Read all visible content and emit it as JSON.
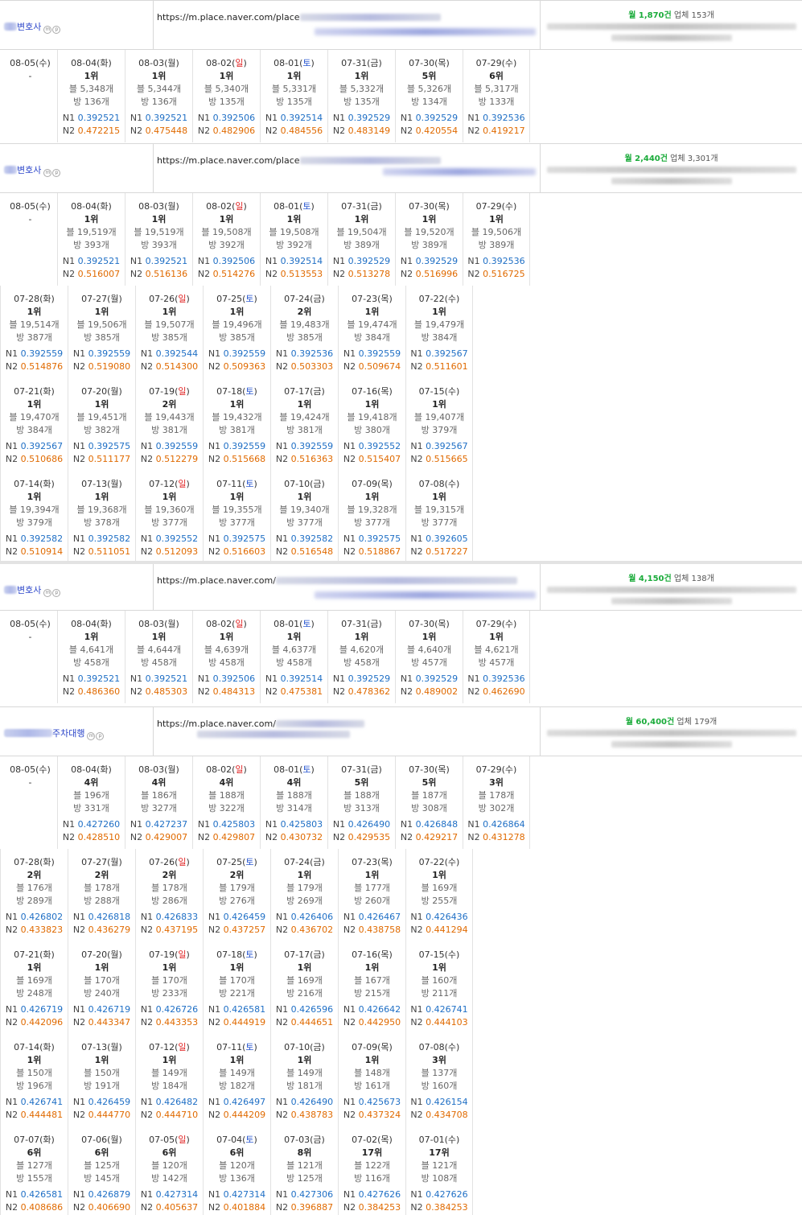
{
  "blocks": [
    {
      "name": "변호사",
      "name_blur": "short",
      "url": "https://m.place.naver.com/place",
      "monthly": "월 1,870건",
      "total": "업체 153개",
      "today": {
        "date": "08-05(수)",
        "rank": "-"
      },
      "rows": [
        [
          {
            "d": "08-04",
            "w": "화",
            "t": "",
            "r": "1위",
            "b": "블 5,348개",
            "v": "방 136개",
            "n1": "0.392521",
            "n2": "0.472215"
          },
          {
            "d": "08-03",
            "w": "월",
            "t": "",
            "r": "1위",
            "b": "블 5,344개",
            "v": "방 136개",
            "n1": "0.392521",
            "n2": "0.475448"
          },
          {
            "d": "08-02",
            "w": "일",
            "t": "sun",
            "r": "1위",
            "b": "블 5,340개",
            "v": "방 135개",
            "n1": "0.392506",
            "n2": "0.482906"
          },
          {
            "d": "08-01",
            "w": "토",
            "t": "sat",
            "r": "1위",
            "b": "블 5,331개",
            "v": "방 135개",
            "n1": "0.392514",
            "n2": "0.484556"
          },
          {
            "d": "07-31",
            "w": "금",
            "t": "",
            "r": "1위",
            "b": "블 5,332개",
            "v": "방 135개",
            "n1": "0.392529",
            "n2": "0.483149"
          },
          {
            "d": "07-30",
            "w": "목",
            "t": "",
            "r": "5위",
            "b": "블 5,326개",
            "v": "방 134개",
            "n1": "0.392529",
            "n2": "0.420554"
          },
          {
            "d": "07-29",
            "w": "수",
            "t": "",
            "r": "6위",
            "b": "블 5,317개",
            "v": "방 133개",
            "n1": "0.392536",
            "n2": "0.419217"
          }
        ]
      ]
    },
    {
      "name": "변호사",
      "name_blur": "short",
      "url": "https://m.place.naver.com/place",
      "monthly": "월 2,440건",
      "total": "업체 3,301개",
      "today": {
        "date": "08-05(수)",
        "rank": "-"
      },
      "rows": [
        [
          {
            "d": "08-04",
            "w": "화",
            "t": "",
            "r": "1위",
            "b": "블 19,519개",
            "v": "방 393개",
            "n1": "0.392521",
            "n2": "0.516007"
          },
          {
            "d": "08-03",
            "w": "월",
            "t": "",
            "r": "1위",
            "b": "블 19,519개",
            "v": "방 393개",
            "n1": "0.392521",
            "n2": "0.516136"
          },
          {
            "d": "08-02",
            "w": "일",
            "t": "sun",
            "r": "1위",
            "b": "블 19,508개",
            "v": "방 392개",
            "n1": "0.392506",
            "n2": "0.514276"
          },
          {
            "d": "08-01",
            "w": "토",
            "t": "sat",
            "r": "1위",
            "b": "블 19,508개",
            "v": "방 392개",
            "n1": "0.392514",
            "n2": "0.513553"
          },
          {
            "d": "07-31",
            "w": "금",
            "t": "",
            "r": "1위",
            "b": "블 19,504개",
            "v": "방 389개",
            "n1": "0.392529",
            "n2": "0.513278"
          },
          {
            "d": "07-30",
            "w": "목",
            "t": "",
            "r": "1위",
            "b": "블 19,520개",
            "v": "방 389개",
            "n1": "0.392529",
            "n2": "0.516996"
          },
          {
            "d": "07-29",
            "w": "수",
            "t": "",
            "r": "1위",
            "b": "블 19,506개",
            "v": "방 389개",
            "n1": "0.392536",
            "n2": "0.516725"
          }
        ],
        [
          {
            "d": "07-28",
            "w": "화",
            "t": "",
            "r": "1위",
            "b": "블 19,514개",
            "v": "방 387개",
            "n1": "0.392559",
            "n2": "0.514876"
          },
          {
            "d": "07-27",
            "w": "월",
            "t": "",
            "r": "1위",
            "b": "블 19,506개",
            "v": "방 385개",
            "n1": "0.392559",
            "n2": "0.519080"
          },
          {
            "d": "07-26",
            "w": "일",
            "t": "sun",
            "r": "1위",
            "b": "블 19,507개",
            "v": "방 385개",
            "n1": "0.392544",
            "n2": "0.514300"
          },
          {
            "d": "07-25",
            "w": "토",
            "t": "sat",
            "r": "1위",
            "b": "블 19,496개",
            "v": "방 385개",
            "n1": "0.392559",
            "n2": "0.509363"
          },
          {
            "d": "07-24",
            "w": "금",
            "t": "",
            "r": "2위",
            "b": "블 19,483개",
            "v": "방 385개",
            "n1": "0.392536",
            "n2": "0.503303"
          },
          {
            "d": "07-23",
            "w": "목",
            "t": "",
            "r": "1위",
            "b": "블 19,474개",
            "v": "방 384개",
            "n1": "0.392559",
            "n2": "0.509674"
          },
          {
            "d": "07-22",
            "w": "수",
            "t": "",
            "r": "1위",
            "b": "블 19,479개",
            "v": "방 384개",
            "n1": "0.392567",
            "n2": "0.511601"
          }
        ],
        [
          {
            "d": "07-21",
            "w": "화",
            "t": "",
            "r": "1위",
            "b": "블 19,470개",
            "v": "방 384개",
            "n1": "0.392567",
            "n2": "0.510686"
          },
          {
            "d": "07-20",
            "w": "월",
            "t": "",
            "r": "1위",
            "b": "블 19,451개",
            "v": "방 382개",
            "n1": "0.392575",
            "n2": "0.511177"
          },
          {
            "d": "07-19",
            "w": "일",
            "t": "sun",
            "r": "2위",
            "b": "블 19,443개",
            "v": "방 381개",
            "n1": "0.392559",
            "n2": "0.512279"
          },
          {
            "d": "07-18",
            "w": "토",
            "t": "sat",
            "r": "1위",
            "b": "블 19,432개",
            "v": "방 381개",
            "n1": "0.392559",
            "n2": "0.515668"
          },
          {
            "d": "07-17",
            "w": "금",
            "t": "",
            "r": "1위",
            "b": "블 19,424개",
            "v": "방 381개",
            "n1": "0.392559",
            "n2": "0.516363"
          },
          {
            "d": "07-16",
            "w": "목",
            "t": "",
            "r": "1위",
            "b": "블 19,418개",
            "v": "방 380개",
            "n1": "0.392552",
            "n2": "0.515407"
          },
          {
            "d": "07-15",
            "w": "수",
            "t": "",
            "r": "1위",
            "b": "블 19,407개",
            "v": "방 379개",
            "n1": "0.392567",
            "n2": "0.515665"
          }
        ],
        [
          {
            "d": "07-14",
            "w": "화",
            "t": "",
            "r": "1위",
            "b": "블 19,394개",
            "v": "방 379개",
            "n1": "0.392582",
            "n2": "0.510914"
          },
          {
            "d": "07-13",
            "w": "월",
            "t": "",
            "r": "1위",
            "b": "블 19,368개",
            "v": "방 378개",
            "n1": "0.392582",
            "n2": "0.511051"
          },
          {
            "d": "07-12",
            "w": "일",
            "t": "sun",
            "r": "1위",
            "b": "블 19,360개",
            "v": "방 377개",
            "n1": "0.392552",
            "n2": "0.512093"
          },
          {
            "d": "07-11",
            "w": "토",
            "t": "sat",
            "r": "1위",
            "b": "블 19,355개",
            "v": "방 377개",
            "n1": "0.392575",
            "n2": "0.516603"
          },
          {
            "d": "07-10",
            "w": "금",
            "t": "",
            "r": "1위",
            "b": "블 19,340개",
            "v": "방 377개",
            "n1": "0.392582",
            "n2": "0.516548"
          },
          {
            "d": "07-09",
            "w": "목",
            "t": "",
            "r": "1위",
            "b": "블 19,328개",
            "v": "방 377개",
            "n1": "0.392575",
            "n2": "0.518867"
          },
          {
            "d": "07-08",
            "w": "수",
            "t": "",
            "r": "1위",
            "b": "블 19,315개",
            "v": "방 377개",
            "n1": "0.392605",
            "n2": "0.517227"
          }
        ]
      ]
    },
    {
      "name": "변호사",
      "name_blur": "short",
      "url": "https://m.place.naver.com/",
      "monthly": "월 4,150건",
      "total": "업체 138개",
      "today": {
        "date": "08-05(수)",
        "rank": "-"
      },
      "rows": [
        [
          {
            "d": "08-04",
            "w": "화",
            "t": "",
            "r": "1위",
            "b": "블 4,641개",
            "v": "방 458개",
            "n1": "0.392521",
            "n2": "0.486360"
          },
          {
            "d": "08-03",
            "w": "월",
            "t": "",
            "r": "1위",
            "b": "블 4,644개",
            "v": "방 458개",
            "n1": "0.392521",
            "n2": "0.485303"
          },
          {
            "d": "08-02",
            "w": "일",
            "t": "sun",
            "r": "1위",
            "b": "블 4,639개",
            "v": "방 458개",
            "n1": "0.392506",
            "n2": "0.484313"
          },
          {
            "d": "08-01",
            "w": "토",
            "t": "sat",
            "r": "1위",
            "b": "블 4,637개",
            "v": "방 458개",
            "n1": "0.392514",
            "n2": "0.475381"
          },
          {
            "d": "07-31",
            "w": "금",
            "t": "",
            "r": "1위",
            "b": "블 4,620개",
            "v": "방 458개",
            "n1": "0.392529",
            "n2": "0.478362"
          },
          {
            "d": "07-30",
            "w": "목",
            "t": "",
            "r": "1위",
            "b": "블 4,640개",
            "v": "방 457개",
            "n1": "0.392529",
            "n2": "0.489002"
          },
          {
            "d": "07-29",
            "w": "수",
            "t": "",
            "r": "1위",
            "b": "블 4,621개",
            "v": "방 457개",
            "n1": "0.392536",
            "n2": "0.462690"
          }
        ]
      ]
    },
    {
      "name": "주차대행",
      "name_blur": "long",
      "url": "https://m.place.naver.com/",
      "monthly": "월 60,400건",
      "total": "업체 179개",
      "today": {
        "date": "08-05(수)",
        "rank": "-"
      },
      "rows": [
        [
          {
            "d": "08-04",
            "w": "화",
            "t": "",
            "r": "4위",
            "b": "블 196개",
            "v": "방 331개",
            "n1": "0.427260",
            "n2": "0.428510"
          },
          {
            "d": "08-03",
            "w": "월",
            "t": "",
            "r": "4위",
            "b": "블 186개",
            "v": "방 327개",
            "n1": "0.427237",
            "n2": "0.429007"
          },
          {
            "d": "08-02",
            "w": "일",
            "t": "sun",
            "r": "4위",
            "b": "블 188개",
            "v": "방 322개",
            "n1": "0.425803",
            "n2": "0.429807"
          },
          {
            "d": "08-01",
            "w": "토",
            "t": "sat",
            "r": "4위",
            "b": "블 188개",
            "v": "방 314개",
            "n1": "0.425803",
            "n2": "0.430732"
          },
          {
            "d": "07-31",
            "w": "금",
            "t": "",
            "r": "5위",
            "b": "블 188개",
            "v": "방 313개",
            "n1": "0.426490",
            "n2": "0.429535"
          },
          {
            "d": "07-30",
            "w": "목",
            "t": "",
            "r": "5위",
            "b": "블 187개",
            "v": "방 308개",
            "n1": "0.426848",
            "n2": "0.429217"
          },
          {
            "d": "07-29",
            "w": "수",
            "t": "",
            "r": "3위",
            "b": "블 178개",
            "v": "방 302개",
            "n1": "0.426864",
            "n2": "0.431278"
          }
        ],
        [
          {
            "d": "07-28",
            "w": "화",
            "t": "",
            "r": "2위",
            "b": "블 176개",
            "v": "방 289개",
            "n1": "0.426802",
            "n2": "0.433823"
          },
          {
            "d": "07-27",
            "w": "월",
            "t": "",
            "r": "2위",
            "b": "블 178개",
            "v": "방 288개",
            "n1": "0.426818",
            "n2": "0.436279"
          },
          {
            "d": "07-26",
            "w": "일",
            "t": "sun",
            "r": "2위",
            "b": "블 178개",
            "v": "방 286개",
            "n1": "0.426833",
            "n2": "0.437195"
          },
          {
            "d": "07-25",
            "w": "토",
            "t": "sat",
            "r": "2위",
            "b": "블 179개",
            "v": "방 276개",
            "n1": "0.426459",
            "n2": "0.437257"
          },
          {
            "d": "07-24",
            "w": "금",
            "t": "",
            "r": "1위",
            "b": "블 179개",
            "v": "방 269개",
            "n1": "0.426406",
            "n2": "0.436702"
          },
          {
            "d": "07-23",
            "w": "목",
            "t": "",
            "r": "1위",
            "b": "블 177개",
            "v": "방 260개",
            "n1": "0.426467",
            "n2": "0.438758"
          },
          {
            "d": "07-22",
            "w": "수",
            "t": "",
            "r": "1위",
            "b": "블 169개",
            "v": "방 255개",
            "n1": "0.426436",
            "n2": "0.441294"
          }
        ],
        [
          {
            "d": "07-21",
            "w": "화",
            "t": "",
            "r": "1위",
            "b": "블 169개",
            "v": "방 248개",
            "n1": "0.426719",
            "n2": "0.442096"
          },
          {
            "d": "07-20",
            "w": "월",
            "t": "",
            "r": "1위",
            "b": "블 170개",
            "v": "방 240개",
            "n1": "0.426719",
            "n2": "0.443347"
          },
          {
            "d": "07-19",
            "w": "일",
            "t": "sun",
            "r": "1위",
            "b": "블 170개",
            "v": "방 233개",
            "n1": "0.426726",
            "n2": "0.443353"
          },
          {
            "d": "07-18",
            "w": "토",
            "t": "sat",
            "r": "1위",
            "b": "블 170개",
            "v": "방 221개",
            "n1": "0.426581",
            "n2": "0.444919"
          },
          {
            "d": "07-17",
            "w": "금",
            "t": "",
            "r": "1위",
            "b": "블 169개",
            "v": "방 216개",
            "n1": "0.426596",
            "n2": "0.444651"
          },
          {
            "d": "07-16",
            "w": "목",
            "t": "",
            "r": "1위",
            "b": "블 167개",
            "v": "방 215개",
            "n1": "0.426642",
            "n2": "0.442950"
          },
          {
            "d": "07-15",
            "w": "수",
            "t": "",
            "r": "1위",
            "b": "블 160개",
            "v": "방 211개",
            "n1": "0.426741",
            "n2": "0.444103"
          }
        ],
        [
          {
            "d": "07-14",
            "w": "화",
            "t": "",
            "r": "1위",
            "b": "블 150개",
            "v": "방 196개",
            "n1": "0.426741",
            "n2": "0.444481"
          },
          {
            "d": "07-13",
            "w": "월",
            "t": "",
            "r": "1위",
            "b": "블 150개",
            "v": "방 191개",
            "n1": "0.426459",
            "n2": "0.444770"
          },
          {
            "d": "07-12",
            "w": "일",
            "t": "sun",
            "r": "1위",
            "b": "블 149개",
            "v": "방 184개",
            "n1": "0.426482",
            "n2": "0.444710"
          },
          {
            "d": "07-11",
            "w": "토",
            "t": "sat",
            "r": "1위",
            "b": "블 149개",
            "v": "방 182개",
            "n1": "0.426497",
            "n2": "0.444209"
          },
          {
            "d": "07-10",
            "w": "금",
            "t": "",
            "r": "1위",
            "b": "블 149개",
            "v": "방 181개",
            "n1": "0.426490",
            "n2": "0.438783"
          },
          {
            "d": "07-09",
            "w": "목",
            "t": "",
            "r": "1위",
            "b": "블 148개",
            "v": "방 161개",
            "n1": "0.425673",
            "n2": "0.437324"
          },
          {
            "d": "07-08",
            "w": "수",
            "t": "",
            "r": "3위",
            "b": "블 137개",
            "v": "방 160개",
            "n1": "0.426154",
            "n2": "0.434708"
          }
        ],
        [
          {
            "d": "07-07",
            "w": "화",
            "t": "",
            "r": "6위",
            "b": "블 127개",
            "v": "방 155개",
            "n1": "0.426581",
            "n2": "0.408686"
          },
          {
            "d": "07-06",
            "w": "월",
            "t": "",
            "r": "6위",
            "b": "블 125개",
            "v": "방 145개",
            "n1": "0.426879",
            "n2": "0.406690"
          },
          {
            "d": "07-05",
            "w": "일",
            "t": "sun",
            "r": "6위",
            "b": "블 120개",
            "v": "방 142개",
            "n1": "0.427314",
            "n2": "0.405637"
          },
          {
            "d": "07-04",
            "w": "토",
            "t": "sat",
            "r": "6위",
            "b": "블 120개",
            "v": "방 136개",
            "n1": "0.427314",
            "n2": "0.401884"
          },
          {
            "d": "07-03",
            "w": "금",
            "t": "",
            "r": "8위",
            "b": "블 121개",
            "v": "방 125개",
            "n1": "0.427306",
            "n2": "0.396887"
          },
          {
            "d": "07-02",
            "w": "목",
            "t": "",
            "r": "17위",
            "b": "블 122개",
            "v": "방 116개",
            "n1": "0.427626",
            "n2": "0.384253"
          },
          {
            "d": "07-01",
            "w": "수",
            "t": "",
            "r": "17위",
            "b": "블 121개",
            "v": "방 108개",
            "n1": "0.427626",
            "n2": "0.384253"
          }
        ]
      ]
    }
  ]
}
